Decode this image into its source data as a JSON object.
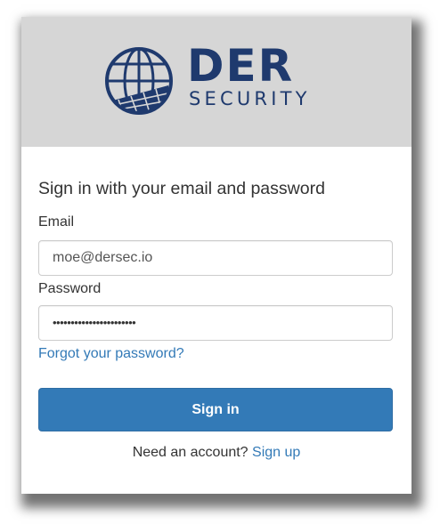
{
  "brand": {
    "word": "DER",
    "subword": "SECURITY",
    "color": "#1f3a6e"
  },
  "form": {
    "heading": "Sign in with your email and password",
    "email_label": "Email",
    "email_value": "moe@dersec.io",
    "password_label": "Password",
    "password_value": "•••••••••••••••••••••••",
    "forgot_link": "Forgot your password?",
    "submit_label": "Sign in"
  },
  "footer": {
    "prompt": "Need an account?",
    "signup_link": "Sign up"
  },
  "colors": {
    "banner": "#d6d6d6",
    "primary": "#337ab7",
    "link": "#337ab7"
  }
}
